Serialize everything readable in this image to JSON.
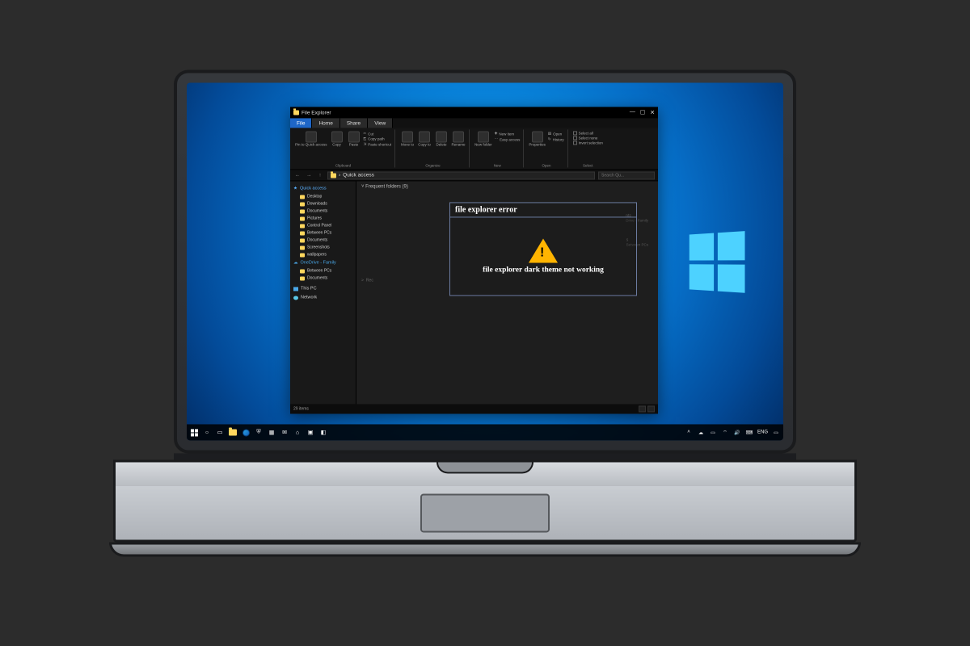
{
  "fileExplorer": {
    "title": "File Explorer",
    "tabs": {
      "file": "File",
      "home": "Home",
      "share": "Share",
      "view": "View"
    },
    "ribbon": {
      "group1": {
        "pin": "Pin to Quick access",
        "copy": "Copy",
        "paste": "Paste",
        "cut": "Cut",
        "copypath": "Copy path",
        "shortcut": "Paste shortcut",
        "label": "Clipboard"
      },
      "group2": {
        "moveto": "Move to",
        "copyto": "Copy to",
        "delete": "Delete",
        "rename": "Rename",
        "label": "Organize"
      },
      "group3": {
        "newfolder": "New folder",
        "newitem": "New item",
        "easyaccess": "Easy access",
        "label": "New"
      },
      "group4": {
        "properties": "Properties",
        "open": "Open",
        "history": "History",
        "label": "Open"
      },
      "group5": {
        "selectall": "Select all",
        "selectnone": "Select none",
        "invert": "Invert selection",
        "label": "Select"
      }
    },
    "breadcrumb": "Quick access",
    "searchPlaceholder": "Search Qu...",
    "sidebar": {
      "quick": "Quick access",
      "items": [
        "Desktop",
        "Downloads",
        "Documents",
        "Pictures",
        "Control Panel",
        "Between PCs",
        "Documents",
        "Screenshots",
        "wallpapers"
      ],
      "onedrive": "OneDrive - Family",
      "odItems": [
        "Between PCs",
        "Documents"
      ],
      "thispc": "This PC",
      "network": "Network"
    },
    "content": {
      "section": "Frequent folders (9)",
      "ghostA1": "nts",
      "ghostA2": "Drive - Family",
      "ghostB1": "s",
      "ghostB2": "Between PCs",
      "recent": "Rec"
    },
    "status": {
      "items": "29 items"
    }
  },
  "errorDialog": {
    "title": "file explorer error",
    "message": "file explorer dark theme not working"
  },
  "taskbar": {
    "tray": {
      "lang": "ENG",
      "time": ""
    }
  }
}
